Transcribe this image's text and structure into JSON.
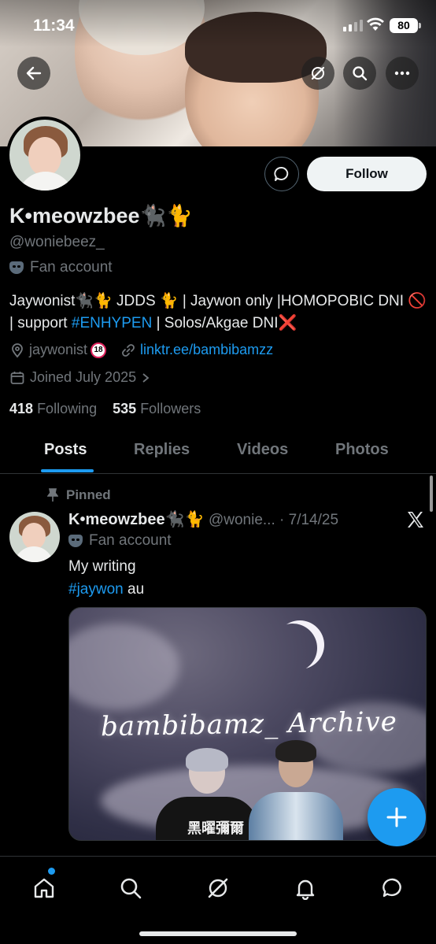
{
  "status_bar": {
    "time": "11:34",
    "battery": "80"
  },
  "profile": {
    "display_name": "K•meowzbee🐈‍⬛🐈",
    "handle": "@woniebeez_",
    "label": "Fan account",
    "bio_part1": "Jaywonist🐈‍⬛🐈 JDDS 🐈 | Jaywon only |HOMOPOBIC DNI 🚫 | support ",
    "bio_hashtag": "#ENHYPEN",
    "bio_part2": " | Solos/Akgae DNI❌",
    "location": "jaywonist",
    "location_badge": "18",
    "website": "linktr.ee/bambibamzz",
    "joined": "Joined July 2025",
    "following_count": "418",
    "following_label": "Following",
    "followers_count": "535",
    "followers_label": "Followers",
    "follow_button": "Follow"
  },
  "tabs": [
    {
      "label": "Posts"
    },
    {
      "label": "Replies"
    },
    {
      "label": "Videos"
    },
    {
      "label": "Photos"
    }
  ],
  "post": {
    "pinned_label": "Pinned",
    "author_name": "K•meowzbee🐈‍⬛🐈",
    "author_handle_date": "@wonie... · 7/14/25",
    "author_label": "Fan account",
    "text_line1": "My writing",
    "hashtag": "#jaywon",
    "text_after_hashtag": " au",
    "media_title": "bambibamz_ Archive",
    "media_caption_text": "黑曜彌爾"
  },
  "icons": {
    "back": "back-arrow-icon",
    "grok": "grok-icon",
    "search": "search-icon",
    "more": "more-icon",
    "message": "message-icon",
    "location": "location-pin-icon",
    "link": "link-icon",
    "calendar": "calendar-icon",
    "pin": "pin-icon",
    "x_logo": "x-logo-icon",
    "compose": "plus-icon",
    "nav_home": "home-icon",
    "nav_search": "search-icon",
    "nav_grok": "grok-icon",
    "nav_notifications": "bell-icon",
    "nav_messages": "chat-icon"
  },
  "colors": {
    "accent": "#1d9bf0",
    "background": "#000000",
    "secondary_text": "#71767b",
    "primary_text": "#e7e9ea"
  }
}
